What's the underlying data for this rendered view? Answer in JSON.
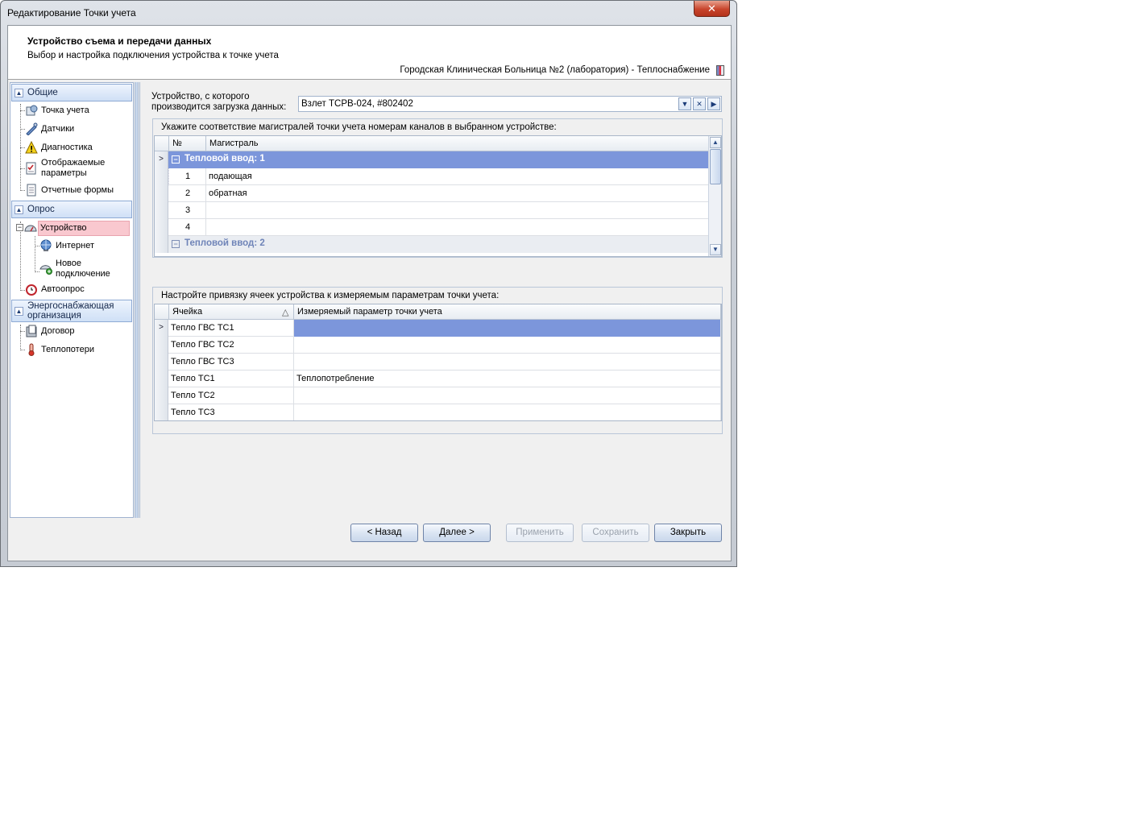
{
  "window": {
    "title": "Редактирование Точки учета",
    "close_glyph": "✕"
  },
  "header": {
    "title": "Устройство съема и передачи данных",
    "subtitle": "Выбор и настройка подключения устройства к точке учета",
    "location": "Городская Клиническая Больница №2 (лаборатория) - Теплоснабжение"
  },
  "nav": {
    "groups": [
      {
        "label": "Общие",
        "items": [
          "Точка учета",
          "Датчики",
          "Диагностика",
          "Отображаемые параметры",
          "Отчетные формы"
        ]
      },
      {
        "label": "Опрос",
        "items": [
          "Устройство",
          "Интернет",
          "Новое подключение",
          "Автоопрос"
        ]
      },
      {
        "label": "Энергоснабжающая организация",
        "items": [
          "Договор",
          "Теплопотери"
        ]
      }
    ],
    "multiline": {
      "params": [
        "Отображаемые",
        "параметры"
      ],
      "newconn": [
        "Новое",
        "подключение"
      ],
      "energy": [
        "Энергоснабжающая",
        "организация"
      ]
    }
  },
  "device": {
    "label_line1": "Устройство, с которого",
    "label_line2": "производится загрузка данных:",
    "value": "Взлет ТСРВ-024, #802402"
  },
  "channels": {
    "caption": "Укажите соответствие магистралей точки учета номерам каналов в выбранном устройстве:",
    "columns": [
      "№",
      "Магистраль"
    ],
    "group1": "Тепловой ввод: 1",
    "rows": [
      {
        "num": "1",
        "name": "подающая"
      },
      {
        "num": "2",
        "name": "обратная"
      },
      {
        "num": "3",
        "name": ""
      },
      {
        "num": "4",
        "name": ""
      }
    ],
    "group2": "Тепловой ввод: 2"
  },
  "cells": {
    "caption": "Настройте привязку ячеек устройства к измеряемым параметрам точки учета:",
    "columns": [
      "Ячейка",
      "Измеряемый параметр точки учета"
    ],
    "rows": [
      {
        "cell": "Тепло ГВС ТС1",
        "param": ""
      },
      {
        "cell": "Тепло ГВС ТС2",
        "param": ""
      },
      {
        "cell": "Тепло ГВС ТС3",
        "param": ""
      },
      {
        "cell": "Тепло ТС1",
        "param": "Теплопотребление"
      },
      {
        "cell": "Тепло ТС2",
        "param": ""
      },
      {
        "cell": "Тепло ТС3",
        "param": ""
      }
    ]
  },
  "buttons": {
    "back": "< Назад",
    "next": "Далее >",
    "apply": "Применить",
    "save": "Сохранить",
    "close": "Закрыть"
  },
  "colors": {
    "selection": "#7c96db",
    "nav_selected": "#f9c8cf"
  }
}
